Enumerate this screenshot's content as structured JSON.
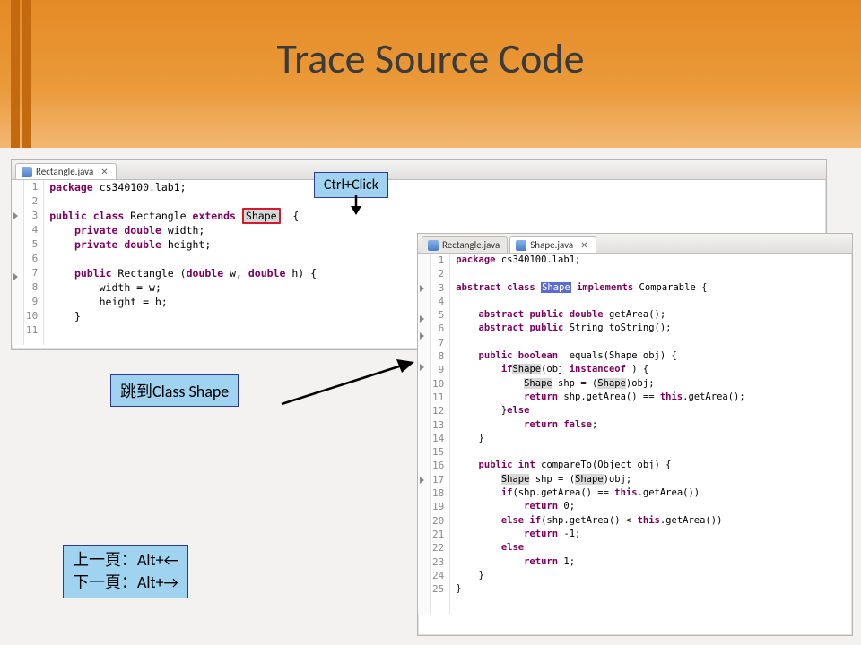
{
  "title": "Trace Source Code",
  "callouts": {
    "ctrlclick": "Ctrl+Click",
    "jump": "跳到Class Shape",
    "nav1": "上一頁：Alt+←",
    "nav2": "下一頁：Alt+→"
  },
  "editor1": {
    "tab": "Rectangle.java",
    "lines": [
      {
        "n": "1",
        "pre": "",
        "kw": "package",
        "post": " cs340100.lab1;"
      },
      {
        "n": "2",
        "pre": "",
        "post": ""
      },
      {
        "n": "3",
        "pre": "",
        "kw": "public class",
        "post_a": " Rectangle ",
        "kw2": "extends",
        "post_b": " ",
        "hl": "Shape",
        "tail": "  {"
      },
      {
        "n": "4",
        "pre": "    ",
        "kw": "private double",
        "post": " width;"
      },
      {
        "n": "5",
        "pre": "    ",
        "kw": "private double",
        "post": " height;"
      },
      {
        "n": "6",
        "pre": "",
        "post": ""
      },
      {
        "n": "7",
        "pre": "    ",
        "kw": "public",
        "post": " Rectangle (",
        "kw2": "double",
        "post2": " w, ",
        "kw3": "double",
        "post3": " h) {"
      },
      {
        "n": "8",
        "pre": "        width = w;",
        "post": ""
      },
      {
        "n": "9",
        "pre": "        height = h;",
        "post": ""
      },
      {
        "n": "10",
        "pre": "    }",
        "post": ""
      },
      {
        "n": "11",
        "pre": "",
        "post": ""
      }
    ]
  },
  "editor2": {
    "tab1": "Rectangle.java",
    "tab2": "Shape.java",
    "lines": [
      {
        "n": "1",
        "kw": "package",
        "post": " cs340100.lab1;"
      },
      {
        "n": "2",
        "post": ""
      },
      {
        "n": "3",
        "kw": "abstract class ",
        "sel": "Shape",
        "post": " ",
        "kw2": "implements",
        "post2": " Comparable {"
      },
      {
        "n": "4",
        "post": ""
      },
      {
        "n": "5",
        "pre": "    ",
        "kw": "abstract public double",
        "post": " getArea();"
      },
      {
        "n": "6",
        "pre": "    ",
        "kw": "abstract public",
        "post": " String toString();"
      },
      {
        "n": "7",
        "post": ""
      },
      {
        "n": "8",
        "pre": "    ",
        "kw": "public boolean",
        "post": "  equals(Shape obj) {"
      },
      {
        "n": "9",
        "pre": "        ",
        "kw": "if",
        "post": "(obj ",
        "kw2": "instanceof",
        "post2": " ",
        "g": "Shape",
        "post3": ") {"
      },
      {
        "n": "10",
        "pre": "            ",
        "g": "Shape",
        "post": " shp = (",
        "g2": "Shape",
        "post2": ")obj;"
      },
      {
        "n": "11",
        "pre": "            ",
        "kw": "return",
        "post": " shp.getArea() == ",
        "kw2": "this",
        "post2": ".getArea();"
      },
      {
        "n": "12",
        "pre": "        }",
        "kw": "else",
        "post": ""
      },
      {
        "n": "13",
        "pre": "            ",
        "kw": "return false",
        "post": ";"
      },
      {
        "n": "14",
        "pre": "    }",
        "post": ""
      },
      {
        "n": "15",
        "post": ""
      },
      {
        "n": "16",
        "pre": "    ",
        "kw": "public int",
        "post": " compareTo(Object obj) {"
      },
      {
        "n": "17",
        "pre": "        ",
        "g": "Shape",
        "post": " shp = (",
        "g2": "Shape",
        "post2": ")obj;"
      },
      {
        "n": "18",
        "pre": "        ",
        "kw": "if",
        "post": "(shp.getArea() == ",
        "kw2": "this",
        "post2": ".getArea())"
      },
      {
        "n": "19",
        "pre": "            ",
        "kw": "return",
        "post": " 0;"
      },
      {
        "n": "20",
        "pre": "        ",
        "kw": "else if",
        "post": "(shp.getArea() < ",
        "kw2": "this",
        "post2": ".getArea())"
      },
      {
        "n": "21",
        "pre": "            ",
        "kw": "return",
        "post": " -1;"
      },
      {
        "n": "22",
        "pre": "        ",
        "kw": "else",
        "post": ""
      },
      {
        "n": "23",
        "pre": "            ",
        "kw": "return",
        "post": " 1;"
      },
      {
        "n": "24",
        "pre": "    }",
        "post": ""
      },
      {
        "n": "25",
        "pre": "}",
        "post": ""
      }
    ]
  }
}
